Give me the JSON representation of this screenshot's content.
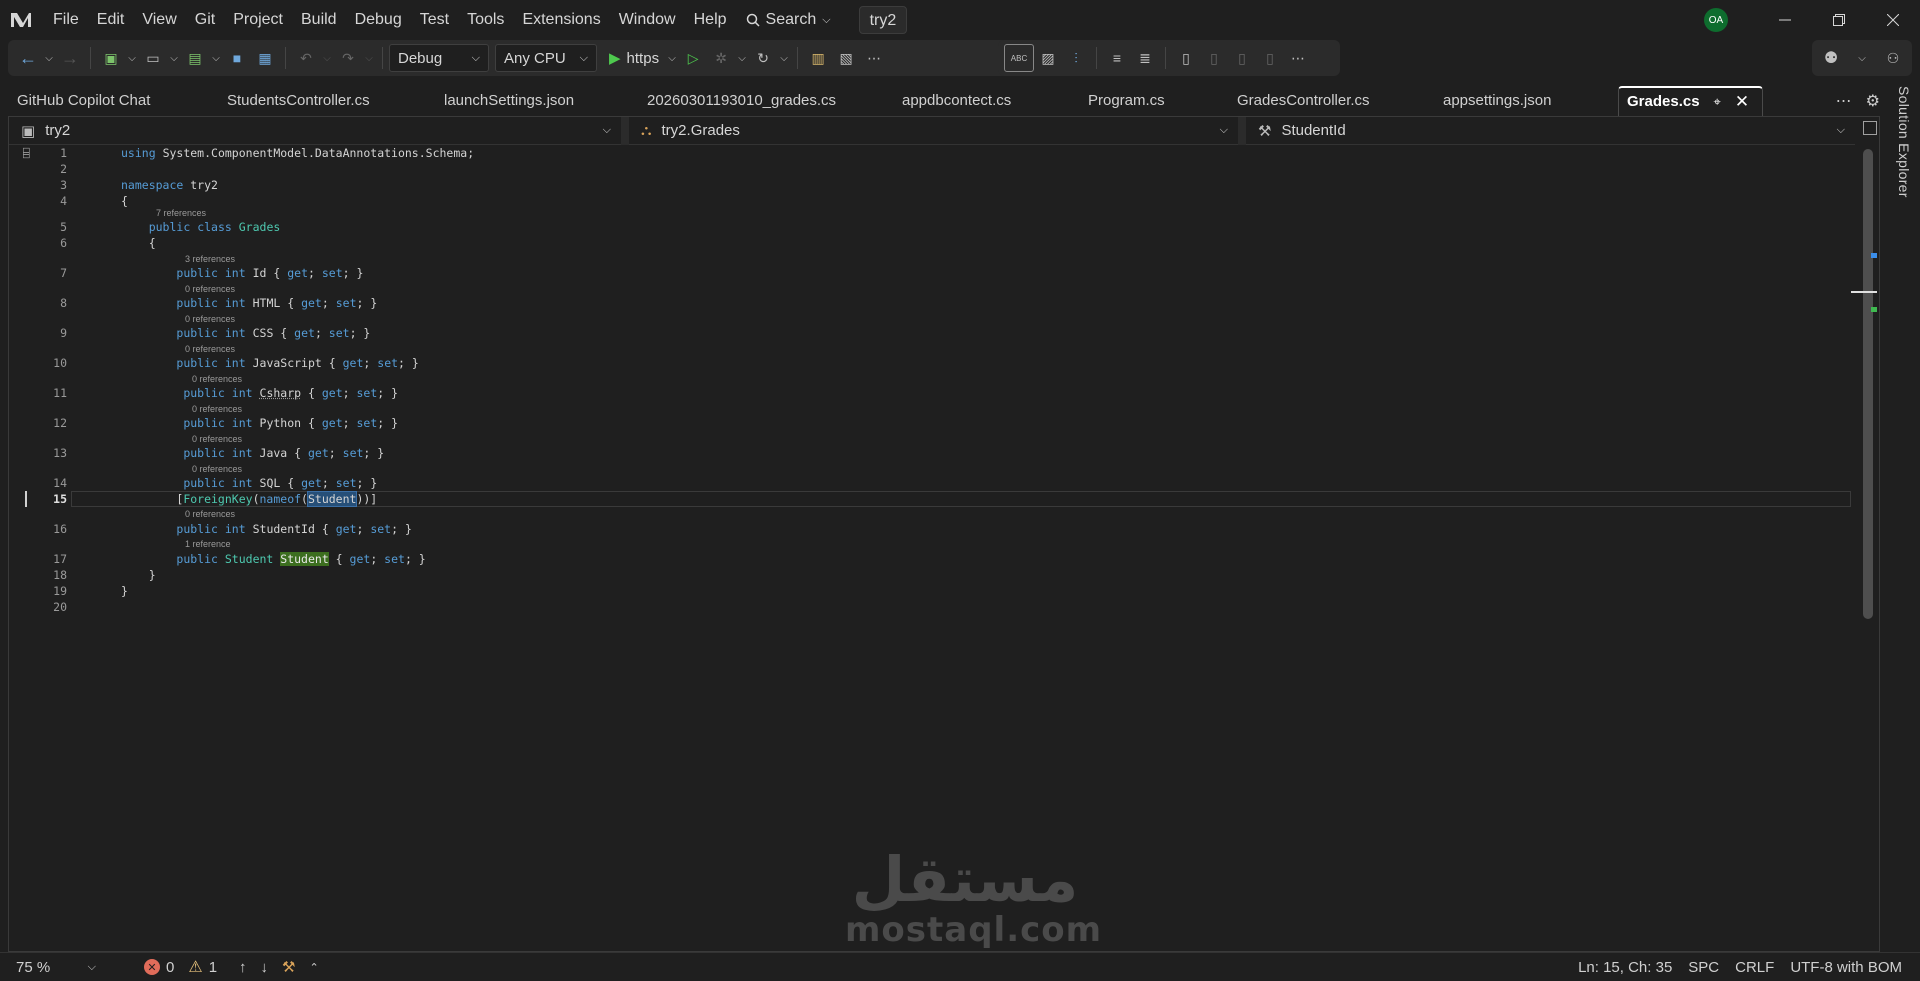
{
  "menu": [
    "File",
    "Edit",
    "View",
    "Git",
    "Project",
    "Build",
    "Debug",
    "Test",
    "Tools",
    "Extensions",
    "Window",
    "Help"
  ],
  "search_label": "Search",
  "solution_name": "try2",
  "user_initials": "OA",
  "toolbar": {
    "config": "Debug",
    "platform": "Any CPU",
    "run_profile": "https",
    "spellcheck_badge": "ABC"
  },
  "tabs": [
    {
      "label": "GitHub Copilot Chat"
    },
    {
      "label": "StudentsController.cs"
    },
    {
      "label": "launchSettings.json"
    },
    {
      "label": "20260301193010_grades.cs"
    },
    {
      "label": "appdbcontect.cs"
    },
    {
      "label": "Program.cs"
    },
    {
      "label": "GradesController.cs"
    },
    {
      "label": "appsettings.json"
    }
  ],
  "active_tab": "Grades.cs",
  "solution_explorer_label": "Solution Explorer",
  "navbar": {
    "project": "try2",
    "type": "try2.Grades",
    "member": "StudentId"
  },
  "code": {
    "line_numbers": [
      "1",
      "2",
      "3",
      "4",
      "5",
      "6",
      "7",
      "8",
      "9",
      "10",
      "11",
      "12",
      "13",
      "14",
      "15",
      "16",
      "17",
      "18",
      "19",
      "20"
    ],
    "lens": {
      "class_refs": "7 references",
      "id_refs": "3 references",
      "zero_refs": "0 references",
      "one_ref": "1 reference"
    },
    "tokens": {
      "using": "using",
      "using_ns": "System.ComponentModel.DataAnnotations.Schema;",
      "namespace": "namespace",
      "ns_name": "try2",
      "public": "public",
      "class": "class",
      "class_name": "Grades",
      "int": "int",
      "get": "get",
      "set": "set",
      "nameof": "nameof",
      "foreign_key": "ForeignKey",
      "student_type": "Student",
      "props": [
        "Id",
        "HTML",
        "CSS",
        "JavaScript",
        "Csharp",
        "Python",
        "Java",
        "SQL",
        "StudentId",
        "Student"
      ]
    }
  },
  "watermark": {
    "arabic": "مستقل",
    "latin": "mostaql.com"
  },
  "status": {
    "zoom": "75 %",
    "errors": "0",
    "warnings": "1",
    "position": "Ln: 15, Ch: 35",
    "whitespace": "SPC",
    "line_endings": "CRLF",
    "encoding": "UTF-8 with BOM"
  }
}
